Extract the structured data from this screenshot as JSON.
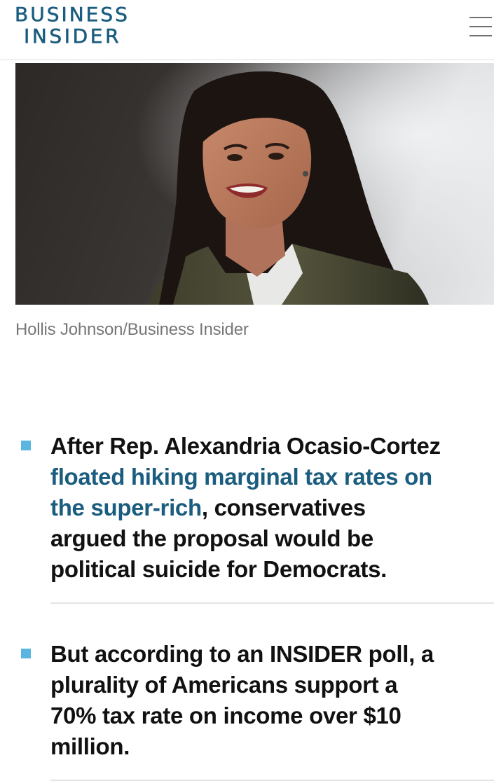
{
  "header": {
    "logo_line1": "BUSINESS",
    "logo_line2": "INSIDER",
    "brand_color": "#1b5d7e",
    "menu_icon": "hamburger-menu-icon"
  },
  "hero": {
    "caption": "Hollis Johnson/Business Insider"
  },
  "bullets": [
    {
      "text_before": "After Rep. Alexandria Ocasio-Cortez ",
      "link_text": "floated hiking marginal tax rates on the super-rich",
      "text_after": ", conservatives argued the proposal would be political suicide for Democrats."
    },
    {
      "text": "But according to an INSIDER poll, a plurality of Americans support a 70% tax rate on income over $10 million."
    }
  ],
  "colors": {
    "bullet_marker": "#5bb6df",
    "link": "#1b5d7e",
    "caption": "#777777"
  }
}
